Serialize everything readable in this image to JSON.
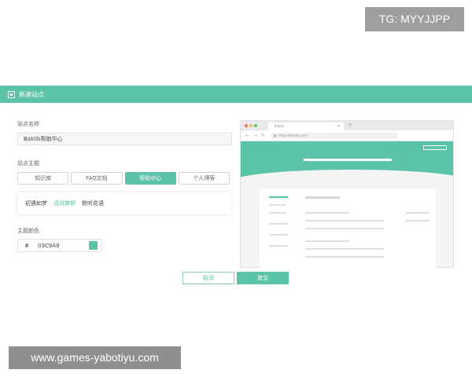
{
  "overlays": {
    "tg_label": "TG: MYYJJPP",
    "site_url": "www.games-yabotiyu.com"
  },
  "modal": {
    "title": "新建站点",
    "site_name_label": "站点名称",
    "site_name_value": "Baklib帮助中心",
    "theme_label": "站点主题",
    "theme_options": [
      "知识库",
      "FAQ文档",
      "帮助中心",
      "个人博客"
    ],
    "theme_selected": "帮助中心",
    "style_options": [
      "初遇如梦",
      "清风拂柳",
      "默听花语"
    ],
    "style_selected": "清风拂柳",
    "color_label": "主题颜色",
    "color_prefix": "#",
    "color_value": "03C9A9",
    "cancel_label": "取消",
    "submit_label": "提交"
  },
  "preview": {
    "tab_title": "baklib",
    "url": "https://baklib.com/"
  },
  "colors": {
    "accent": "#5bc3a7"
  }
}
